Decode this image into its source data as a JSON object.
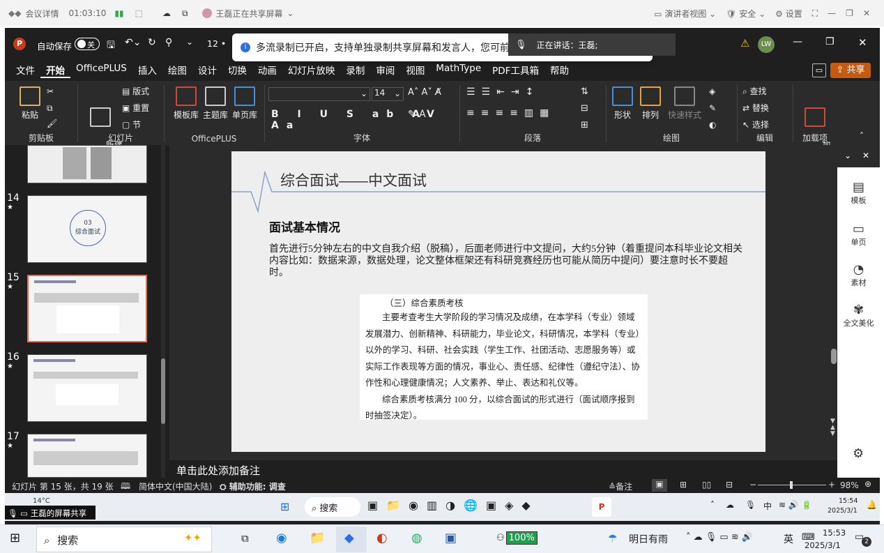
{
  "meeting": {
    "details": "会议详情",
    "time": "01:03:10",
    "sharing_status": "王磊正在共享屏幕",
    "presenter_view": "演讲者视图",
    "security": "安全",
    "settings": "设置"
  },
  "ppt": {
    "autosave": "自动保存",
    "autosave_state": "关",
    "font_size_hint": "12 •",
    "notice": "多流录制已开启，支持单独录制共享屏幕和发言人，您可前",
    "speaking": "正在讲话：王磊;",
    "avatar": "LW",
    "menu_tabs": [
      "文件",
      "开始",
      "OfficePLUS",
      "插入",
      "绘图",
      "设计",
      "切换",
      "动画",
      "幻灯片放映",
      "录制",
      "审阅",
      "视图",
      "MathType",
      "PDF工具箱",
      "帮助"
    ],
    "active_tab": "开始",
    "share_button": "共享",
    "ribbon": {
      "paste": "粘贴",
      "clipboard": "剪贴板",
      "new_slide": "新建\n幻灯片",
      "layout": "版式",
      "reset": "重置",
      "section": "节",
      "slides_group": "幻灯片",
      "template_lib": "模板库",
      "theme_lib": "主题库",
      "single_page": "单页库",
      "officeplus_group": "OfficePLUS",
      "font_size": "14",
      "font_group": "字体",
      "paragraph_group": "段落",
      "shape": "形状",
      "arrange": "排列",
      "quick_style": "快速样式",
      "drawing_group": "绘图",
      "find": "查找",
      "replace": "替换",
      "select": "选择",
      "edit_group": "编辑",
      "addins": "加\n载项",
      "addins_group": "加载项"
    },
    "thumbnails": [
      {
        "num": "14",
        "label": "03\n综合面试"
      },
      {
        "num": "15",
        "label": ""
      },
      {
        "num": "16",
        "label": ""
      },
      {
        "num": "17",
        "label": ""
      }
    ],
    "slide": {
      "title": "综合面试——中文面试",
      "subtitle": "面试基本情况",
      "body": "首先进行5分钟左右的中文自我介绍（脱稿），后面老师进行中文提问，大约5分钟（着重提问本科毕业论文相关内容比如：数据来源，数据处理，论文整体框架还有科研竞赛经历也可能从简历中提问）要注意时长不要超时。",
      "box_heading": "（三）综合素质考核",
      "box_para1": "主要考查考生大学阶段的学习情况及成绩，在本学科（专业）领域发展潜力、创新精神、科研能力，毕业论文，科研情况，本学科（专业）以外的学习、科研、社会实践（学生工作、社团活动、志愿服务等）或实际工作表现等方面的情况，事业心、责任感、纪律性（遵纪守法）、协作性和心理健康情况；人文素养、举止、表达和礼仪等。",
      "box_para2": "综合素质考核满分 100 分，以综合面试的形式进行（面试顺序报到时抽签决定）。"
    },
    "notes_placeholder": "单击此处添加备注",
    "right_pane": [
      "模板",
      "单页",
      "素材",
      "全文美化"
    ],
    "status": {
      "slide_info": "幻灯片 第 15 张，共 19 张",
      "language": "简体中文(中国大陆)",
      "accessibility": "辅助功能: 调查",
      "notes": "备注",
      "zoom": "98%"
    }
  },
  "inner_taskbar": {
    "weather_temp": "14°C",
    "screen_share": "王磊的屏幕共享",
    "search": "搜索",
    "ime": "中",
    "time": "15:54",
    "date": "2025/3/1"
  },
  "outer_taskbar": {
    "search": "搜索",
    "battery": "100%",
    "weather": "明日有雨",
    "ime": "英",
    "time": "15:53",
    "date": "2025/3/1",
    "badge": "2"
  },
  "colors": {
    "accent_orange": "#c55a11",
    "ppt_red": "#c43e1c",
    "dark_bg": "#1f1f1f",
    "ribbon_bg": "#2b2b2b"
  }
}
